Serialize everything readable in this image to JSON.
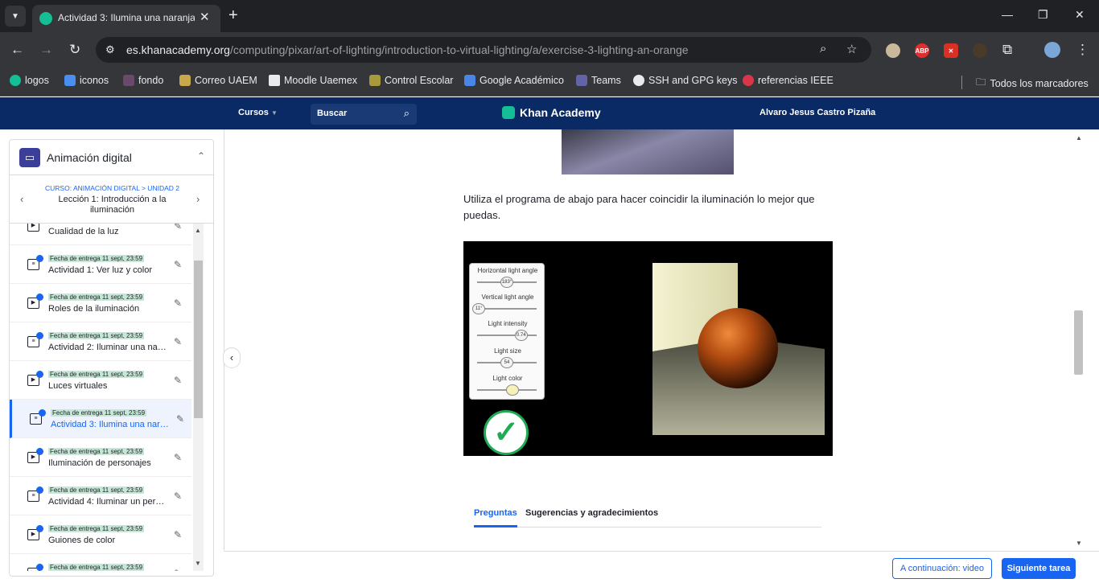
{
  "browser": {
    "tab_title": "Actividad 3: Ilumina una naranja",
    "url_host": "es.khanacademy.org",
    "url_path": "/computing/pixar/art-of-lighting/introduction-to-virtual-lighting/a/exercise-3-lighting-an-orange",
    "ext_abp": "ABP",
    "bookmarks": [
      "logos",
      "iconos",
      "fondo",
      "Correo UAEM",
      "Moodle Uaemex",
      "Control Escolar",
      "Google Académico",
      "Teams",
      "SSH and GPG keys",
      "referencias IEEE"
    ],
    "all_bookmarks": "Todos los marcadores"
  },
  "header": {
    "courses": "Cursos",
    "search": "Buscar",
    "logo": "Khan Academy",
    "user": "Alvaro Jesus Castro Pizaña"
  },
  "sidebar": {
    "title": "Animación digital",
    "breadcrumb": "CURSO: ANIMACIÓN DIGITAL > UNIDAD 2",
    "lesson": "Lección 1: Introducción a la iluminación",
    "items": [
      {
        "due": "Fecha de entrega 11 sept, 23:59",
        "title": "Cualidad de la luz",
        "kind": "video"
      },
      {
        "due": "Fecha de entrega 11 sept, 23:59",
        "title": "Actividad 1: Ver luz y color",
        "kind": "exercise"
      },
      {
        "due": "Fecha de entrega 11 sept, 23:59",
        "title": "Roles de la iluminación",
        "kind": "video"
      },
      {
        "due": "Fecha de entrega 11 sept, 23:59",
        "title": "Actividad 2: Iluminar una naranja",
        "kind": "exercise"
      },
      {
        "due": "Fecha de entrega 11 sept, 23:59",
        "title": "Luces virtuales",
        "kind": "video"
      },
      {
        "due": "Fecha de entrega 11 sept, 23:59",
        "title": "Actividad 3: Ilumina una naranja",
        "kind": "exercise"
      },
      {
        "due": "Fecha de entrega 11 sept, 23:59",
        "title": "Iluminación de personajes",
        "kind": "video"
      },
      {
        "due": "Fecha de entrega 11 sept, 23:59",
        "title": "Actividad 4: Iluminar un personaje",
        "kind": "exercise"
      },
      {
        "due": "Fecha de entrega 11 sept, 23:59",
        "title": "Guiones de color",
        "kind": "video"
      },
      {
        "due": "Fecha de entrega 11 sept, 23:59",
        "title": "",
        "kind": "video"
      }
    ]
  },
  "main": {
    "instruction": "Utiliza el programa de abajo para hacer coincidir la iluminación lo mejor que puedas.",
    "controls": [
      {
        "label": "Horizontal light angle",
        "value": "183°",
        "level": 0.5
      },
      {
        "label": "Vertical light angle",
        "value": "11°",
        "level": 0.03
      },
      {
        "label": "Light intensity",
        "value": "0.74",
        "level": 0.74
      },
      {
        "label": "Light size",
        "value": "54",
        "level": 0.5
      },
      {
        "label": "Light color",
        "value": "",
        "level": 0.6
      }
    ],
    "tabs": [
      "Preguntas",
      "Sugerencias y agradecimientos"
    ]
  },
  "footer": {
    "next_video": "A continuación: video",
    "next_task": "Siguiente tarea"
  }
}
